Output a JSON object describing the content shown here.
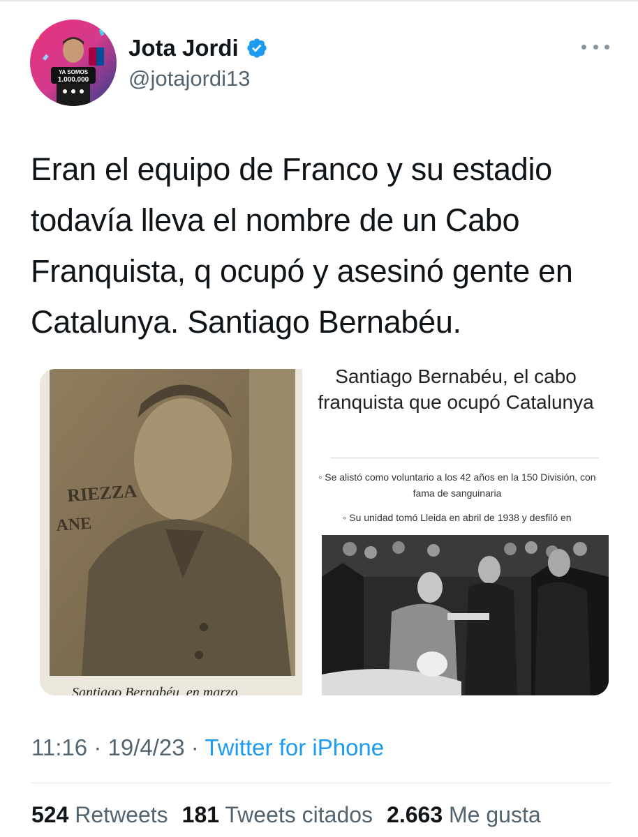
{
  "author": {
    "display_name": "Jota Jordi",
    "handle": "@jotajordi13",
    "avatar_banner_line1": "YA SOMOS",
    "avatar_banner_line2": "1.000.000"
  },
  "tweet": {
    "text": "Eran el equipo de Franco y su estadio todavía lleva el nombre de un Cabo Franquista, q ocupó y asesinó gente en Catalunya. Santiago Bernabéu.",
    "time": "11:16",
    "date": "19/4/23",
    "separator": "·",
    "source": "Twitter for iPhone"
  },
  "media": {
    "left_caption": "Santiago Bernabéu, en marzo",
    "left_poster_text_1": "RIEZZA",
    "left_poster_text_2": "ANE",
    "article_title": "Santiago Bernabéu, el cabo franquista que ocupó Catalunya",
    "bullet_1": "Se alistó como voluntario a los 42 años en la 150 División, con fama de sanguinaria",
    "bullet_2": "Su unidad tomó Lleida en abril de 1938 y desfiló en"
  },
  "stats": {
    "retweets_count": "524",
    "retweets_label": "Retweets",
    "quotes_count": "181",
    "quotes_label": "Tweets citados",
    "likes_count": "2.663",
    "likes_label": "Me gusta"
  },
  "icons": {
    "verified": "verified-badge-icon",
    "more": "more-horizontal-icon"
  },
  "colors": {
    "accent": "#1d9bf0",
    "secondary_text": "#536471",
    "primary_text": "#0f1419"
  }
}
